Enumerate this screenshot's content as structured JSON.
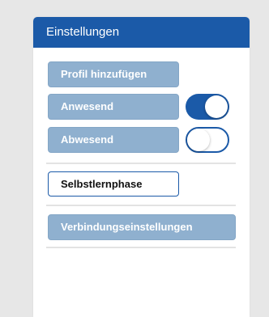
{
  "panel": {
    "title": "Einstellungen"
  },
  "buttons": {
    "add_profile": "Profil hinzufügen",
    "present": "Anwesend",
    "absent": "Abwesend",
    "self_study": "Selbstlernphase",
    "connection_settings": "Verbindungseinstellungen"
  },
  "toggles": {
    "present_on": true,
    "absent_on": false
  },
  "colors": {
    "header_blue": "#1b5aa8",
    "muted_button": "#8fb0cf",
    "page_background": "#e7e7e7"
  }
}
